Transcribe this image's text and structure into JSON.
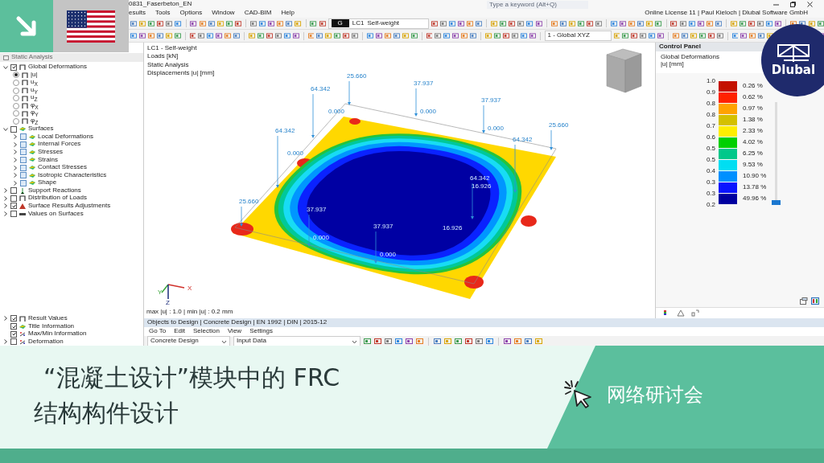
{
  "window": {
    "title": "0831_Faserbeton_EN",
    "search_placeholder": "Type a keyword (Alt+Q)",
    "license": "Online License 11 | Paul Kieloch | Dlubal Software GmbH"
  },
  "menu": [
    "esults",
    "Tools",
    "Options",
    "Window",
    "CAD-BIM",
    "Help"
  ],
  "toolbar": {
    "load_case_tag": "G",
    "load_case": "LC1",
    "load_case_name": "Self-weight",
    "coordinate_system": "1 - Global XYZ"
  },
  "navigator": {
    "title": "Static Analysis",
    "tree": [
      {
        "label": "Global Deformations",
        "kind": "checkbox",
        "checked": true,
        "expanded": true,
        "children": [
          {
            "label": "|u|",
            "kind": "radio",
            "selected": true
          },
          {
            "label": "u$_{X}$",
            "kind": "radio",
            "selected": false
          },
          {
            "label": "u$_{Y}$",
            "kind": "radio",
            "selected": false
          },
          {
            "label": "u$_{Z}$",
            "kind": "radio",
            "selected": false
          },
          {
            "label": "φ$_{X}$",
            "kind": "radio",
            "selected": false
          },
          {
            "label": "φ$_{Y}$",
            "kind": "radio",
            "selected": false
          },
          {
            "label": "φ$_{Z}$",
            "kind": "radio",
            "selected": false
          }
        ]
      },
      {
        "label": "Surfaces",
        "kind": "checkbox",
        "checked": false,
        "expanded": true,
        "children": [
          {
            "label": "Local Deformations",
            "kind": "checkbox",
            "checked": false,
            "expanded": false
          },
          {
            "label": "Internal Forces",
            "kind": "checkbox",
            "checked": false,
            "expanded": false
          },
          {
            "label": "Stresses",
            "kind": "checkbox",
            "checked": false,
            "expanded": false
          },
          {
            "label": "Strains",
            "kind": "checkbox",
            "checked": false,
            "expanded": false
          },
          {
            "label": "Contact Stresses",
            "kind": "checkbox",
            "checked": false,
            "expanded": false
          },
          {
            "label": "Isotropic Characteristics",
            "kind": "checkbox",
            "checked": false,
            "expanded": false
          },
          {
            "label": "Shape",
            "kind": "checkbox",
            "checked": false,
            "expanded": false
          }
        ]
      },
      {
        "label": "Support Reactions",
        "kind": "checkbox",
        "checked": false,
        "expanded": false
      },
      {
        "label": "Distribution of Loads",
        "kind": "checkbox",
        "checked": false,
        "expanded": false
      },
      {
        "label": "Surface Results Adjustments",
        "kind": "checkbox",
        "checked": true,
        "expanded": false
      },
      {
        "label": "Values on Surfaces",
        "kind": "checkbox",
        "checked": false,
        "expanded": false
      }
    ],
    "display_tree": [
      {
        "label": "Result Values",
        "kind": "checkbox",
        "checked": true,
        "expanded": false
      },
      {
        "label": "Title Information",
        "kind": "checkbox",
        "checked": true
      },
      {
        "label": "Max/Min Information",
        "kind": "checkbox",
        "checked": true
      },
      {
        "label": "Deformation",
        "kind": "checkbox",
        "checked": false,
        "expanded": false
      }
    ]
  },
  "viewport": {
    "info": [
      "LC1 - Self-weight",
      "Loads [kN]",
      "Static Analysis",
      "Displacements |u| [mm]"
    ],
    "load_values": [
      "25.660",
      "64.342",
      "37.937",
      "37.937",
      "25.660",
      "64.342",
      "25.660",
      "0.000",
      "0.000",
      "0.000",
      "64.342",
      "0.000",
      "37.937",
      "0.000",
      "37.937",
      "0.000",
      "16.926",
      "64.342",
      "16.926"
    ],
    "axes": [
      "X",
      "Y",
      "Z"
    ],
    "summary": "max |u| : 1.0 | min |u| : 0.2 mm"
  },
  "control_panel": {
    "title": "Control Panel",
    "result": "Global Deformations",
    "unit": "|u| [mm]",
    "ticks": [
      "1.0",
      "0.9",
      "0.8",
      "0.8",
      "0.7",
      "0.6",
      "0.5",
      "0.5",
      "0.4",
      "0.3",
      "0.3",
      "0.2"
    ],
    "bands": [
      {
        "color": "#c41200",
        "share": "0.26 %"
      },
      {
        "color": "#ff2200",
        "share": "0.62 %"
      },
      {
        "color": "#ffa200",
        "share": "0.97 %"
      },
      {
        "color": "#d4c000",
        "share": "1.38 %"
      },
      {
        "color": "#ffee00",
        "share": "2.33 %"
      },
      {
        "color": "#00d000",
        "share": "4.02 %"
      },
      {
        "color": "#00c88a",
        "share": "6.25 %"
      },
      {
        "color": "#00def2",
        "share": "9.53 %"
      },
      {
        "color": "#0090ff",
        "share": "10.90 %"
      },
      {
        "color": "#0a14ff",
        "share": "13.78 %"
      },
      {
        "color": "#0000a0",
        "share": "49.96 %"
      }
    ],
    "slider": {
      "level": 0
    }
  },
  "design_panel": {
    "title": "Objects to Design | Concrete Design | EN 1992 | DIN | 2015-12",
    "menu": [
      "Go To",
      "Edit",
      "Selection",
      "View",
      "Settings"
    ],
    "module": "Concrete Design",
    "table": "Input Data"
  },
  "banner": {
    "logo": "Dlubal",
    "title_lines": [
      "“混凝土设计”模块中的 FRC",
      "结构构件设计"
    ],
    "tag": "网络研讨会"
  }
}
